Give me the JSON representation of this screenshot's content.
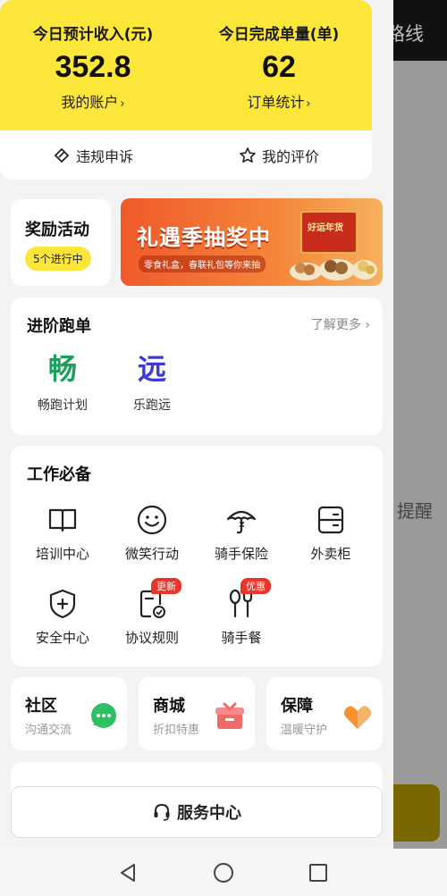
{
  "background_app": {
    "top_title_fragment": "路线",
    "side_text_fragment": "提醒"
  },
  "earnings": {
    "income_label": "今日预计收入(元)",
    "income_value": "352.8",
    "account_link": "我的账户",
    "orders_label": "今日完成单量(单)",
    "orders_value": "62",
    "orders_link": "订单统计",
    "appeal_label": "违规申诉",
    "review_label": "我的评价"
  },
  "reward": {
    "title": "奖励活动",
    "badge": "5个进行中",
    "banner_title": "礼遇季抽奖中",
    "banner_sub": "零食礼盒，春联礼包等你来抽",
    "banner_box_text": "好运年货"
  },
  "run": {
    "title": "进阶跑单",
    "more": "了解更多",
    "items": [
      {
        "glyph": "畅",
        "label": "畅跑计划",
        "color": "#1aa05a"
      },
      {
        "glyph": "远",
        "label": "乐跑远",
        "color": "#3a3ad8"
      }
    ]
  },
  "work": {
    "title": "工作必备",
    "items": [
      {
        "label": "培训中心",
        "icon": "book-icon"
      },
      {
        "label": "微笑行动",
        "icon": "smile-icon"
      },
      {
        "label": "骑手保险",
        "icon": "umbrella-icon"
      },
      {
        "label": "外卖柜",
        "icon": "locker-icon"
      },
      {
        "label": "安全中心",
        "icon": "shield-plus-icon"
      },
      {
        "label": "协议规则",
        "icon": "document-check-icon",
        "tag": "更新"
      },
      {
        "label": "骑手餐",
        "icon": "utensils-icon",
        "tag": "优惠"
      }
    ]
  },
  "mini": [
    {
      "title": "社区",
      "sub": "沟通交流",
      "icon": "chat-bubbles-icon",
      "color": "#2ec163"
    },
    {
      "title": "商城",
      "sub": "折扣特惠",
      "icon": "gift-box-icon",
      "color": "#f05a5a"
    },
    {
      "title": "保障",
      "sub": "温暖守护",
      "icon": "heart-shield-icon",
      "color": "#f7922e"
    }
  ],
  "service": {
    "label": "服务中心"
  },
  "colors": {
    "accent_yellow": "#fde63a",
    "tag_red": "#e8352a"
  }
}
